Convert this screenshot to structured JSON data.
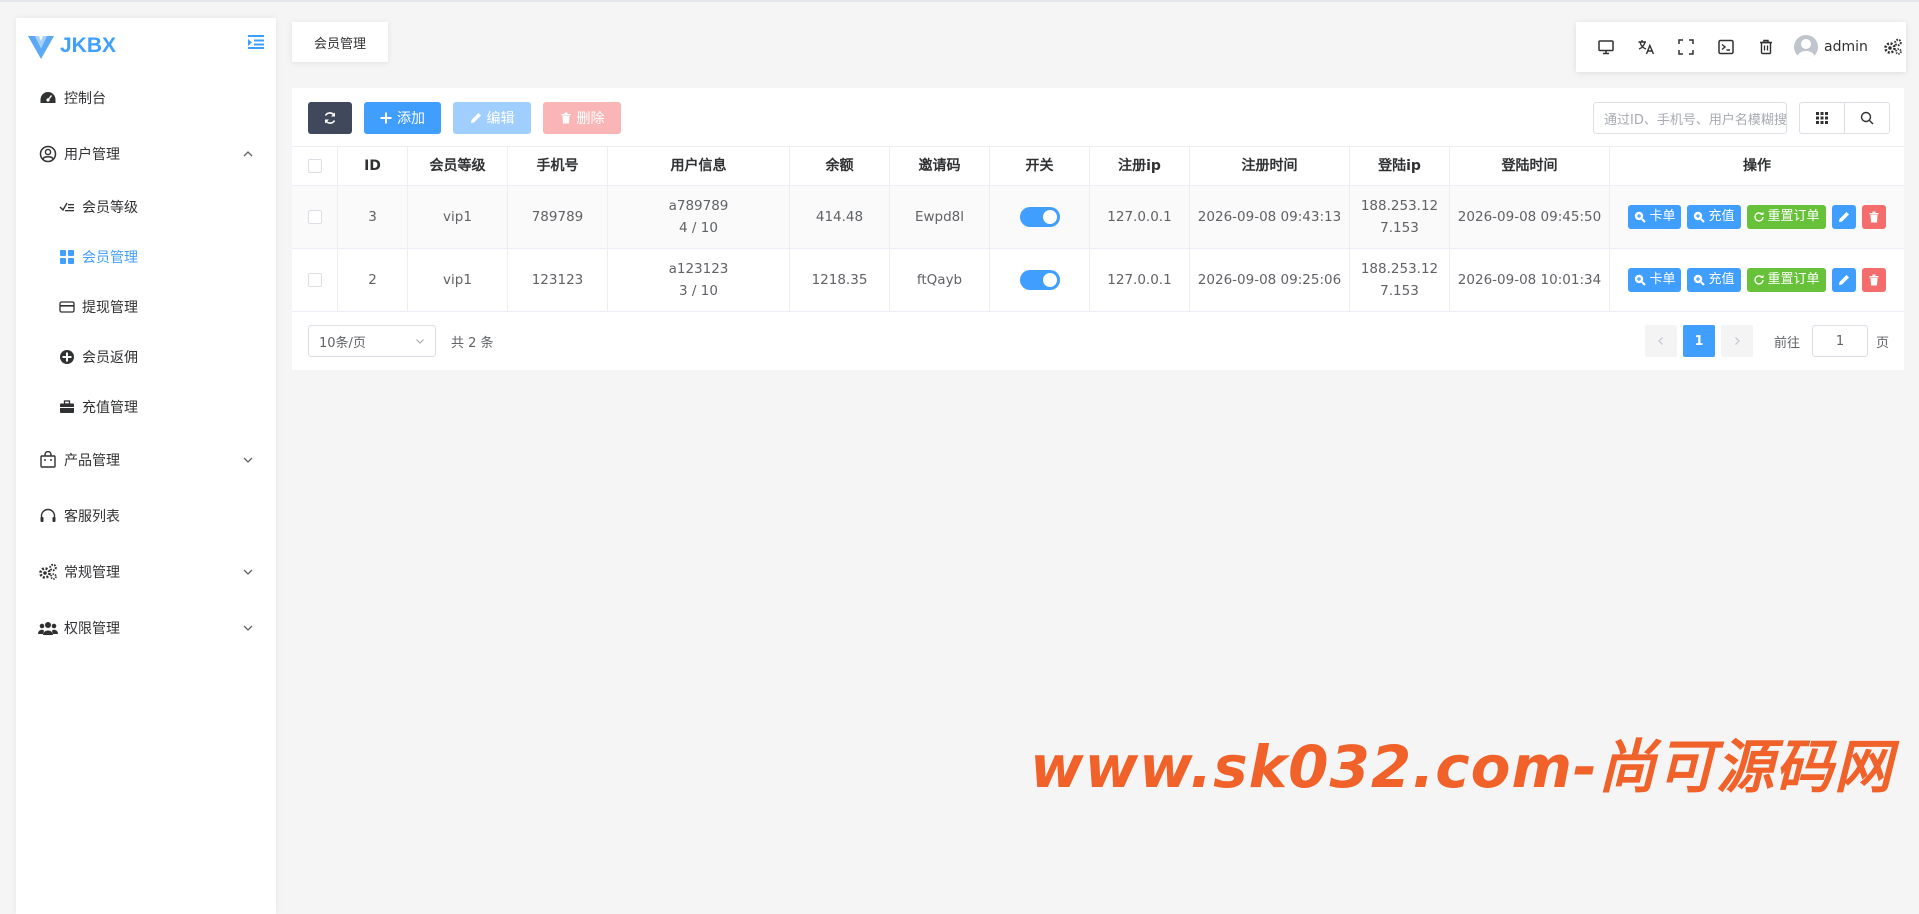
{
  "app": {
    "logo_text": "JKBX"
  },
  "sidebar": {
    "items": [
      {
        "label": "控制台",
        "icon": "dashboard-icon"
      },
      {
        "label": "用户管理",
        "icon": "user-circle-icon",
        "expanded": true,
        "children": [
          {
            "label": "会员等级",
            "icon": "checklist-icon"
          },
          {
            "label": "会员管理",
            "icon": "grid-icon",
            "active": true
          },
          {
            "label": "提现管理",
            "icon": "credit-card-icon"
          },
          {
            "label": "会员返佣",
            "icon": "plus-circle-icon"
          },
          {
            "label": "充值管理",
            "icon": "briefcase-icon"
          }
        ]
      },
      {
        "label": "产品管理",
        "icon": "bag-icon"
      },
      {
        "label": "客服列表",
        "icon": "headset-icon"
      },
      {
        "label": "常规管理",
        "icon": "gears-icon"
      },
      {
        "label": "权限管理",
        "icon": "users-icon"
      }
    ]
  },
  "tabs": [
    {
      "label": "会员管理"
    }
  ],
  "header": {
    "username": "admin"
  },
  "toolbar": {
    "add_label": "添加",
    "edit_label": "编辑",
    "delete_label": "删除",
    "search_placeholder": "通过ID、手机号、用户名模糊搜索"
  },
  "table": {
    "columns": [
      "ID",
      "会员等级",
      "手机号",
      "用户信息",
      "余额",
      "邀请码",
      "开关",
      "注册ip",
      "注册时间",
      "登陆ip",
      "登陆时间",
      "操作"
    ],
    "rows": [
      {
        "id": "3",
        "level": "vip1",
        "phone": "789789",
        "user_name": "a789789",
        "user_ratio": "4 / 10",
        "balance": "414.48",
        "invite": "Ewpd8l",
        "switch_on": true,
        "reg_ip": "127.0.0.1",
        "reg_time": "2026-09-08 09:43:13",
        "login_ip_1": "188.253.12",
        "login_ip_2": "7.153",
        "login_time": "2026-09-08 09:45:50"
      },
      {
        "id": "2",
        "level": "vip1",
        "phone": "123123",
        "user_name": "a123123",
        "user_ratio": "3 / 10",
        "balance": "1218.35",
        "invite": "ftQayb",
        "switch_on": true,
        "reg_ip": "127.0.0.1",
        "reg_time": "2026-09-08 09:25:06",
        "login_ip_1": "188.253.12",
        "login_ip_2": "7.153",
        "login_time": "2026-09-08 10:01:34"
      }
    ],
    "actions": {
      "card": "卡单",
      "recharge": "充值",
      "reset": "重置订单"
    }
  },
  "pagination": {
    "page_size": "10条/页",
    "total": "共 2 条",
    "current": "1",
    "goto_label": "前往",
    "goto_value": "1",
    "page_suffix": "页"
  },
  "watermark": "www.sk032.com-尚可源码网",
  "colors": {
    "primary": "#409eff",
    "success": "#67c23a",
    "danger": "#f56c6c",
    "dark": "#40485b",
    "watermark": "#f0622a"
  }
}
